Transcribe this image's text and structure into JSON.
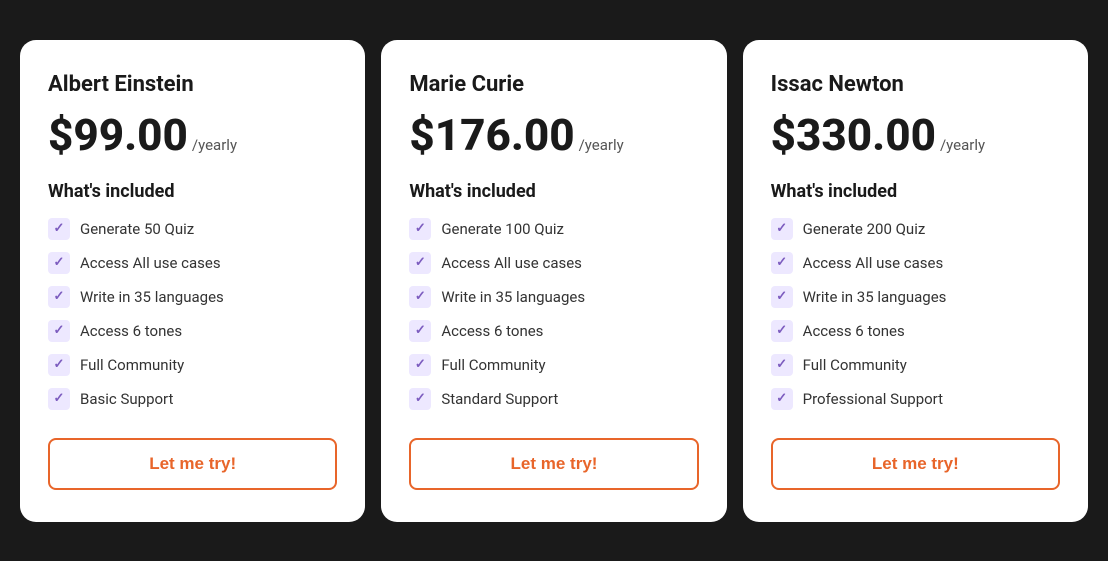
{
  "plans": [
    {
      "id": "albert-einstein",
      "name": "Albert Einstein",
      "price": "$99.00",
      "period": "/yearly",
      "included_title": "What's included",
      "features": [
        "Generate 50 Quiz",
        "Access All use cases",
        "Write in 35 languages",
        "Access 6 tones",
        "Full Community",
        "Basic Support"
      ],
      "cta_label": "Let me try!"
    },
    {
      "id": "marie-curie",
      "name": "Marie Curie",
      "price": "$176.00",
      "period": "/yearly",
      "included_title": "What's included",
      "features": [
        "Generate 100 Quiz",
        "Access All use cases",
        "Write in 35 languages",
        "Access 6 tones",
        "Full Community",
        "Standard Support"
      ],
      "cta_label": "Let me try!"
    },
    {
      "id": "issac-newton",
      "name": "Issac Newton",
      "price": "$330.00",
      "period": "/yearly",
      "included_title": "What's included",
      "features": [
        "Generate 200 Quiz",
        "Access All use cases",
        "Write in 35 languages",
        "Access 6 tones",
        "Full Community",
        "Professional Support"
      ],
      "cta_label": "Let me try!"
    }
  ]
}
